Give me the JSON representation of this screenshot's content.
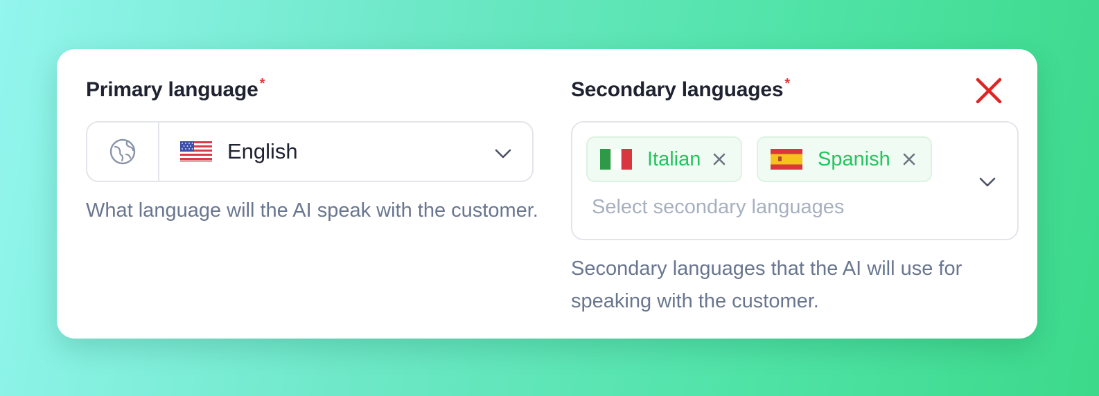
{
  "primary": {
    "label": "Primary language",
    "required_mark": "*",
    "selected": {
      "name": "English",
      "flag": "us-flag-icon"
    },
    "help": "What language will the AI speak with the customer."
  },
  "secondary": {
    "label": "Secondary languages",
    "required_mark": "*",
    "tags": [
      {
        "name": "Italian",
        "flag": "italy-flag-icon"
      },
      {
        "name": "Spanish",
        "flag": "spain-flag-icon"
      }
    ],
    "placeholder": "Select secondary languages",
    "help": "Secondary languages that the AI will use for speaking with the customer."
  },
  "colors": {
    "required": "#e5343a",
    "tag_text": "#22c55e",
    "tag_bg": "#f0fbf3",
    "close": "#e02424",
    "help_text": "#697690"
  }
}
